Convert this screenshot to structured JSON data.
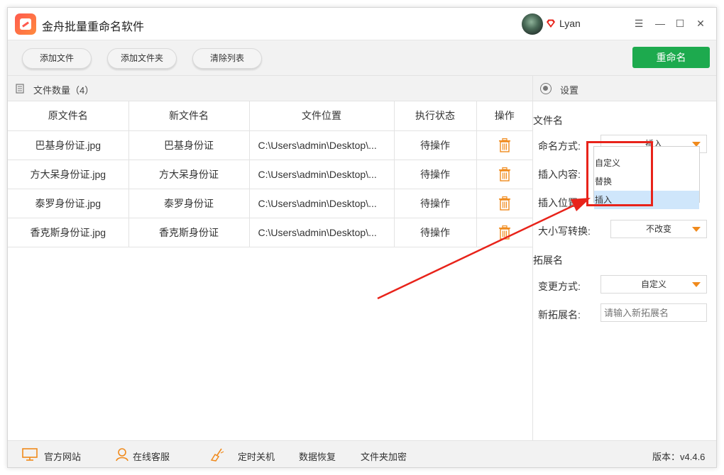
{
  "app": {
    "title": "金舟批量重命名软件",
    "user_name": "Lyan",
    "minimize": "—",
    "maximize": "☐",
    "close": "✕",
    "menu": "☰"
  },
  "toolbar": {
    "add_file": "添加文件",
    "add_folder": "添加文件夹",
    "clear_list": "清除列表",
    "rename": "重命名",
    "rename_color": "#1daa4e"
  },
  "file_list": {
    "count_label": "文件数量（4）",
    "columns": [
      "原文件名",
      "新文件名",
      "文件位置",
      "执行状态",
      "操作"
    ],
    "rows": [
      {
        "original": "巴基身份证.jpg",
        "new": "巴基身份证",
        "location": "C:\\Users\\admin\\Desktop\\...",
        "status": "待操作"
      },
      {
        "original": "方大呆身份证.jpg",
        "new": "方大呆身份证",
        "location": "C:\\Users\\admin\\Desktop\\...",
        "status": "待操作"
      },
      {
        "original": "泰罗身份证.jpg",
        "new": "泰罗身份证",
        "location": "C:\\Users\\admin\\Desktop\\...",
        "status": "待操作"
      },
      {
        "original": "香克斯身份证.jpg",
        "new": "香克斯身份证",
        "location": "C:\\Users\\admin\\Desktop\\...",
        "status": "待操作"
      }
    ]
  },
  "settings": {
    "header": "设置",
    "filename_section": "文件名",
    "naming_mode_label": "命名方式:",
    "naming_mode_value": "插入",
    "insert_content_label": "插入内容:",
    "insert_position_label": "插入位置:",
    "case_label": "大小写转换:",
    "case_value": "不改变",
    "extension_section": "拓展名",
    "change_mode_label": "变更方式:",
    "change_mode_value": "自定义",
    "new_ext_label": "新拓展名:",
    "new_ext_placeholder": "请输入新拓展名",
    "dropdown_options": [
      "自定义",
      "替换",
      "插入"
    ],
    "dropdown_selected": "插入",
    "highlight_color": "#e8231a"
  },
  "footer": {
    "website": "官方网站",
    "support": "在线客服",
    "shutdown": "定时关机",
    "data_recovery": "数据恢复",
    "folder_encrypt": "文件夹加密",
    "version": "版本：v4.4.6"
  }
}
